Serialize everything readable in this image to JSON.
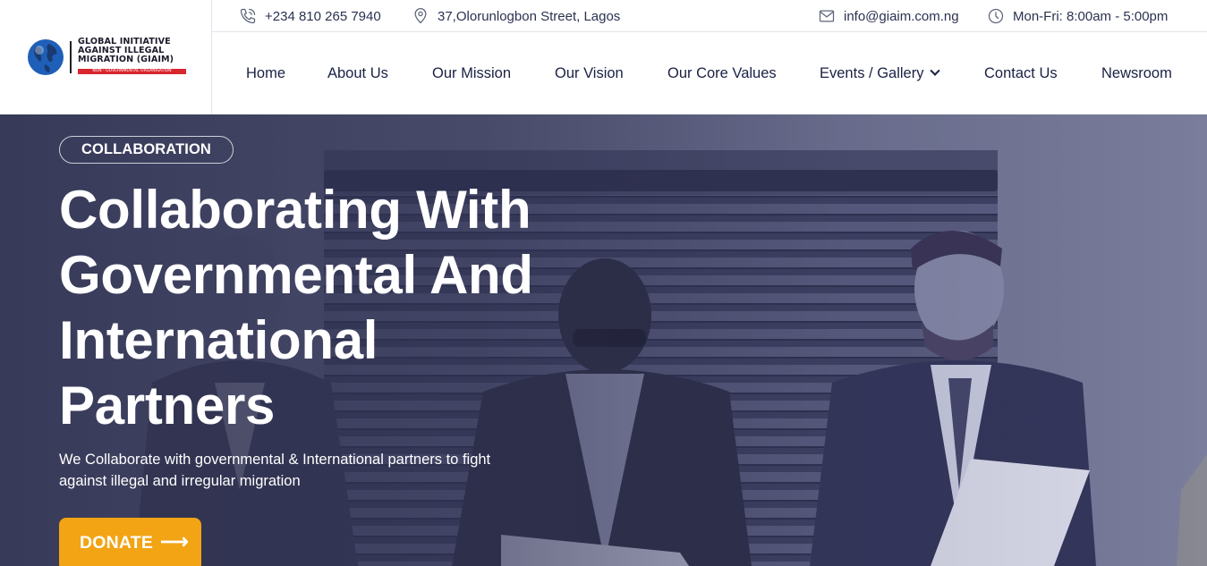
{
  "brand": {
    "logo_lines": [
      "GLOBAL INITIATIVE",
      "AGAINST ILLEGAL",
      "MIGRATION (GIAIM)"
    ],
    "logo_tag": "NON - GOVERNMENTAL ORGANISATION",
    "tag_color": "#d8262e"
  },
  "topbar": {
    "phone": {
      "icon": "phone-icon",
      "text": "+234 810 265 7940"
    },
    "address": {
      "icon": "map-pin-icon",
      "text": "37,Olorunlogbon Street, Lagos"
    },
    "email": {
      "icon": "mail-icon",
      "text": "info@giaim.com.ng"
    },
    "hours": {
      "icon": "clock-icon",
      "text": "Mon-Fri: 8:00am - 5:00pm"
    }
  },
  "nav": {
    "items": [
      {
        "label": "Home"
      },
      {
        "label": "About Us"
      },
      {
        "label": "Our Mission"
      },
      {
        "label": "Our Vision"
      },
      {
        "label": "Our Core Values"
      },
      {
        "label": "Events / Gallery",
        "has_dropdown": true
      },
      {
        "label": "Contact Us"
      },
      {
        "label": "Newsroom"
      }
    ]
  },
  "hero": {
    "badge": "COLLABORATION",
    "title_lines": [
      "Collaborating With",
      "Governmental And",
      "International",
      "Partners"
    ],
    "description_lines": [
      "We Collaborate with governmental & International partners to fight",
      "against illegal and irregular migration"
    ],
    "cta_label": "DONATE",
    "cta_icon": "arrow-right-icon",
    "cta_color": "#f2a414"
  }
}
